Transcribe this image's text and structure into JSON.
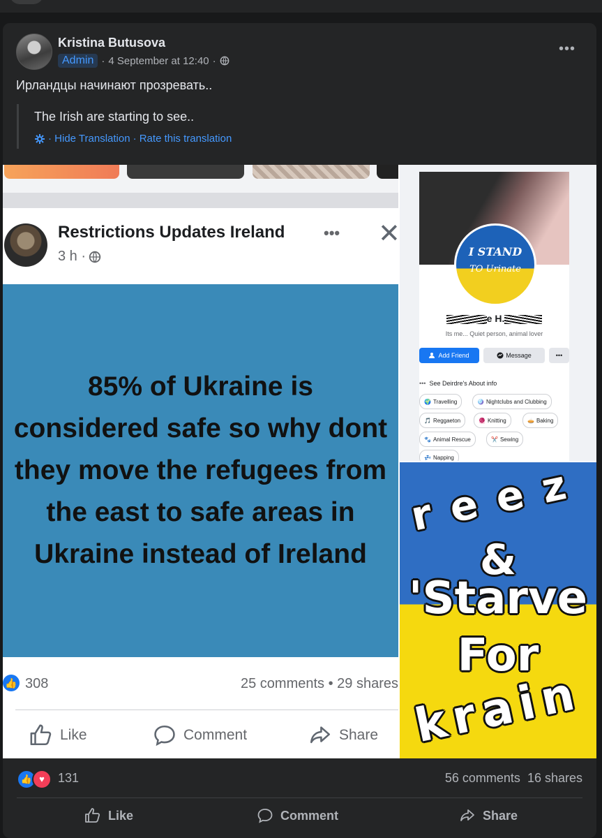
{
  "post": {
    "author": "Kristina Butusova",
    "role_badge": "Admin",
    "timestamp": "4 September at 12:40",
    "meta_sep": "·",
    "text": "Ирландцы начинают прозревать..",
    "translation": "The Irish are starting to see..",
    "hide_translation": "· Hide Translation",
    "rate_translation": "· Rate this translation",
    "more_label": "•••"
  },
  "shared_post": {
    "page_name": "Restrictions Updates Ireland",
    "time": "3 h ·",
    "message": "85% of Ukraine is considered safe so why dont they move the refugees from the east to safe areas in Ukraine instead of Ireland",
    "likes": "308",
    "comments_shares": "25 comments • 29 shares",
    "actions": {
      "like": "Like",
      "comment": "Comment",
      "share": "Share"
    },
    "dots": "•••",
    "close": "✕"
  },
  "profile_screenshot": {
    "picture_text_1": "I STAND",
    "picture_text_2": "TO Urinate",
    "name_visible": "e H.",
    "bio": "Its me... Quiet person, animal lover",
    "add_friend": "Add Friend",
    "message": "Message",
    "more": "•••",
    "about_link": "See Deirdre's About info",
    "interests": [
      "Travelling",
      "Nightclubs and Clubbing",
      "Reggaeton",
      "Knitting",
      "Baking",
      "Animal Rescue",
      "Sewing",
      "Napping"
    ]
  },
  "meme": {
    "line1": "reez",
    "line2": "&",
    "line3": "'Starve",
    "line4": "For",
    "line5": "krain"
  },
  "stats": {
    "reactions": "131",
    "comments": "56 comments",
    "shares": "16 shares"
  },
  "actions": {
    "like": "Like",
    "comment": "Comment",
    "share": "Share"
  },
  "colors": {
    "background": "#18191a",
    "card": "#242526",
    "link": "#4599ff",
    "ukraine_blue": "#2f6ec3",
    "ukraine_yellow": "#f5d90f",
    "panel_blue": "#3a8ab8"
  },
  "icons": {
    "globe": "globe-icon",
    "gear": "gear-icon",
    "like": "thumbs-up-icon",
    "comment": "comment-bubble-icon",
    "share": "share-arrow-icon",
    "love": "heart-icon"
  }
}
